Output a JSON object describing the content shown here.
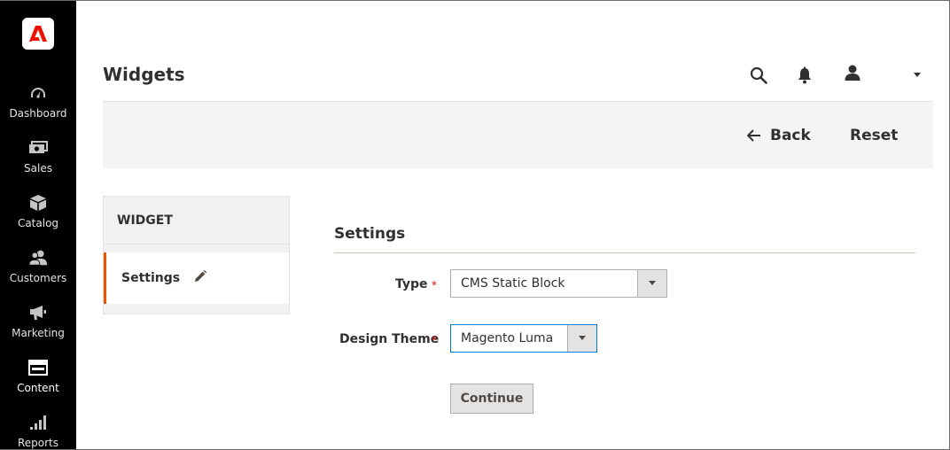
{
  "app": {
    "page_title": "Widgets",
    "brand_color": "#eb5202"
  },
  "sidebar": {
    "items": [
      {
        "label": "Dashboard",
        "icon": "dashboard-icon"
      },
      {
        "label": "Sales",
        "icon": "sales-icon"
      },
      {
        "label": "Catalog",
        "icon": "catalog-icon"
      },
      {
        "label": "Customers",
        "icon": "customers-icon"
      },
      {
        "label": "Marketing",
        "icon": "marketing-icon"
      },
      {
        "label": "Content",
        "icon": "content-icon",
        "active": true
      },
      {
        "label": "Reports",
        "icon": "reports-icon"
      }
    ]
  },
  "header": {
    "icons": [
      "search-icon",
      "bell-icon",
      "user-icon",
      "caret-down-icon"
    ]
  },
  "actions": {
    "back_label": "Back",
    "reset_label": "Reset"
  },
  "tabs": {
    "heading": "WIDGET",
    "items": [
      {
        "label": "Settings",
        "icon": "pencil-icon"
      }
    ]
  },
  "form": {
    "section_title": "Settings",
    "fields": {
      "type": {
        "label": "Type",
        "value": "CMS Static Block",
        "required": true
      },
      "design_theme": {
        "label": "Design Theme",
        "value": "Magento Luma",
        "required": true
      }
    },
    "required_marker": "*",
    "continue_label": "Continue"
  }
}
